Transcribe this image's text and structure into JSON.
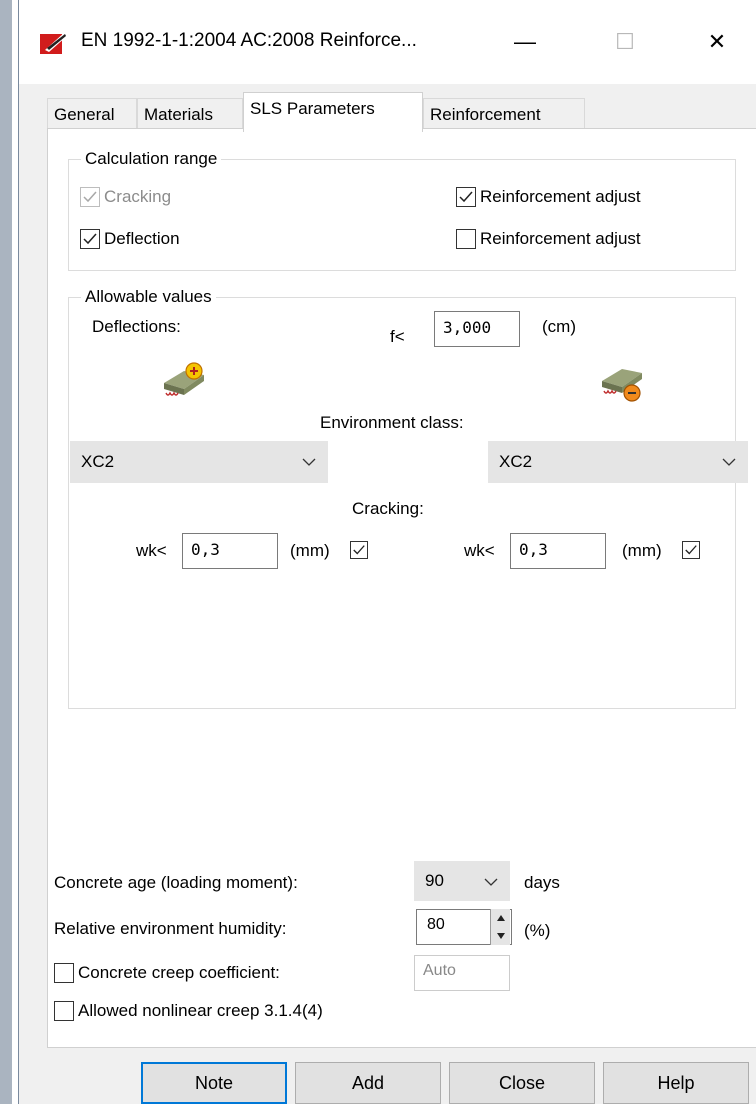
{
  "window": {
    "title": "EN 1992-1-1:2004 AC:2008 Reinforce...",
    "minimize_glyph": "—",
    "maximize_glyph": "☐",
    "close_glyph": "✕"
  },
  "tabs": [
    {
      "label": "General",
      "active": false
    },
    {
      "label": "Materials",
      "active": false
    },
    {
      "label": "SLS Parameters",
      "active": true
    },
    {
      "label": "Reinforcement",
      "active": false
    }
  ],
  "calc_range": {
    "legend": "Calculation range",
    "cracking_label": "Cracking",
    "cracking_checked": true,
    "cracking_enabled": false,
    "deflection_label": "Deflection",
    "deflection_checked": true,
    "reinf_adjust_1_label": "Reinforcement adjust",
    "reinf_adjust_1_checked": true,
    "reinf_adjust_2_label": "Reinforcement adjust",
    "reinf_adjust_2_checked": false
  },
  "allowable": {
    "legend": "Allowable values",
    "deflections_label": "Deflections:",
    "f_label": "f<",
    "f_value": "3,000",
    "f_unit": "(cm)",
    "env_class_label": "Environment class:",
    "env_class_top": "XC2",
    "env_class_bottom": "XC2",
    "cracking_label": "Cracking:",
    "wk_label": "wk<",
    "wk_top_value": "0,3",
    "wk_top_unit": "(mm)",
    "wk_top_checked": true,
    "wk_bottom_value": "0,3",
    "wk_bottom_unit": "(mm)",
    "wk_bottom_checked": true
  },
  "bottom": {
    "age_label": "Concrete age (loading moment):",
    "age_value": "90",
    "age_unit": "days",
    "humidity_label": "Relative environment humidity:",
    "humidity_value": "80",
    "humidity_unit": "(%)",
    "creep_coef_label": "Concrete creep coefficient:",
    "creep_coef_checked": false,
    "creep_coef_value": "Auto",
    "nonlinear_label": "Allowed nonlinear creep 3.1.4(4)",
    "nonlinear_checked": false
  },
  "buttons": {
    "note": "Note",
    "add": "Add",
    "close": "Close",
    "help": "Help"
  },
  "colors": {
    "accent": "#0078d7",
    "icon_red": "#e02020",
    "icon_yellow": "#f4c400",
    "icon_orange": "#f08a1c"
  }
}
